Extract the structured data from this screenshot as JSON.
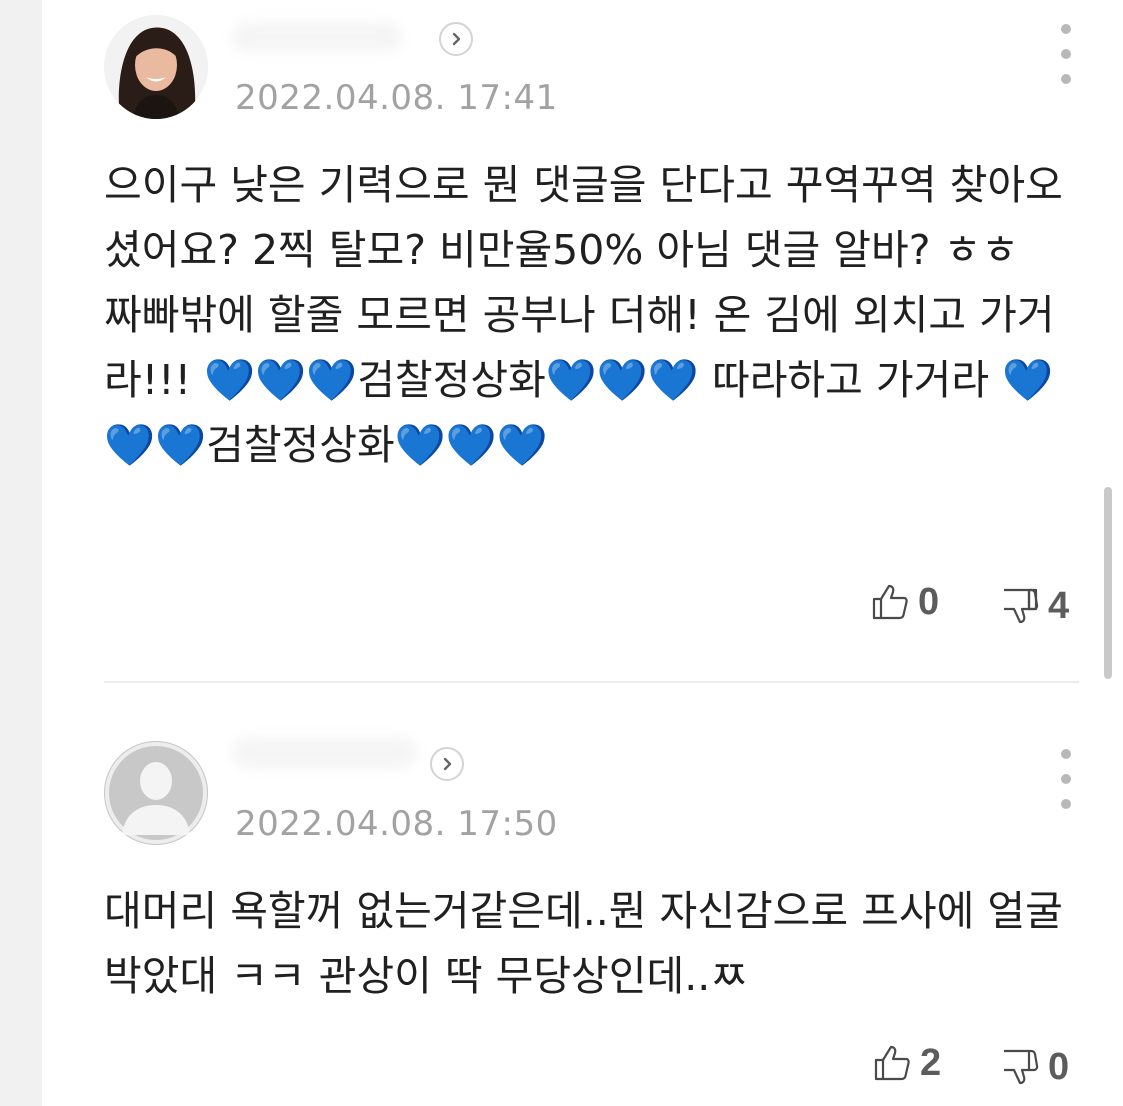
{
  "comments": [
    {
      "timestamp": "2022.04.08. 17:41",
      "text": "으이구 낮은 기력으로 뭔 댓글을 단다고 꾸역꾸역 찾아오셨어요? 2찍 탈모? 비만율50% 아님 댓글 알바? ㅎㅎ 짜빠밖에 할줄 모르면 공부나 더해! 온 김에 외치고 가거라!!! 💙💙💙검찰정상화💙💙💙 따라하고 가거라 💙💙💙검찰정상화💙💙💙",
      "likes": "0",
      "dislikes": "4",
      "avatar": "profile-photo-woman",
      "profile_link_icon": "chevron-right-icon",
      "menu_icon": "more-vertical-icon"
    },
    {
      "timestamp": "2022.04.08. 17:50",
      "text": "대머리 욕할꺼 없는거같은데..뭔 자신감으로 프사에 얼굴 박았대 ㅋㅋ 관상이 딱 무당상인데..ㅉ",
      "likes": "2",
      "dislikes": "0",
      "avatar": "default-person-avatar",
      "profile_link_icon": "chevron-right-icon",
      "menu_icon": "more-vertical-icon"
    }
  ],
  "colors": {
    "background": "#f1f1f1",
    "panel": "#ffffff",
    "text": "#202020",
    "timestamp": "#a2a2a2",
    "count": "#5c5c5c",
    "heart": "#2f6df6"
  }
}
